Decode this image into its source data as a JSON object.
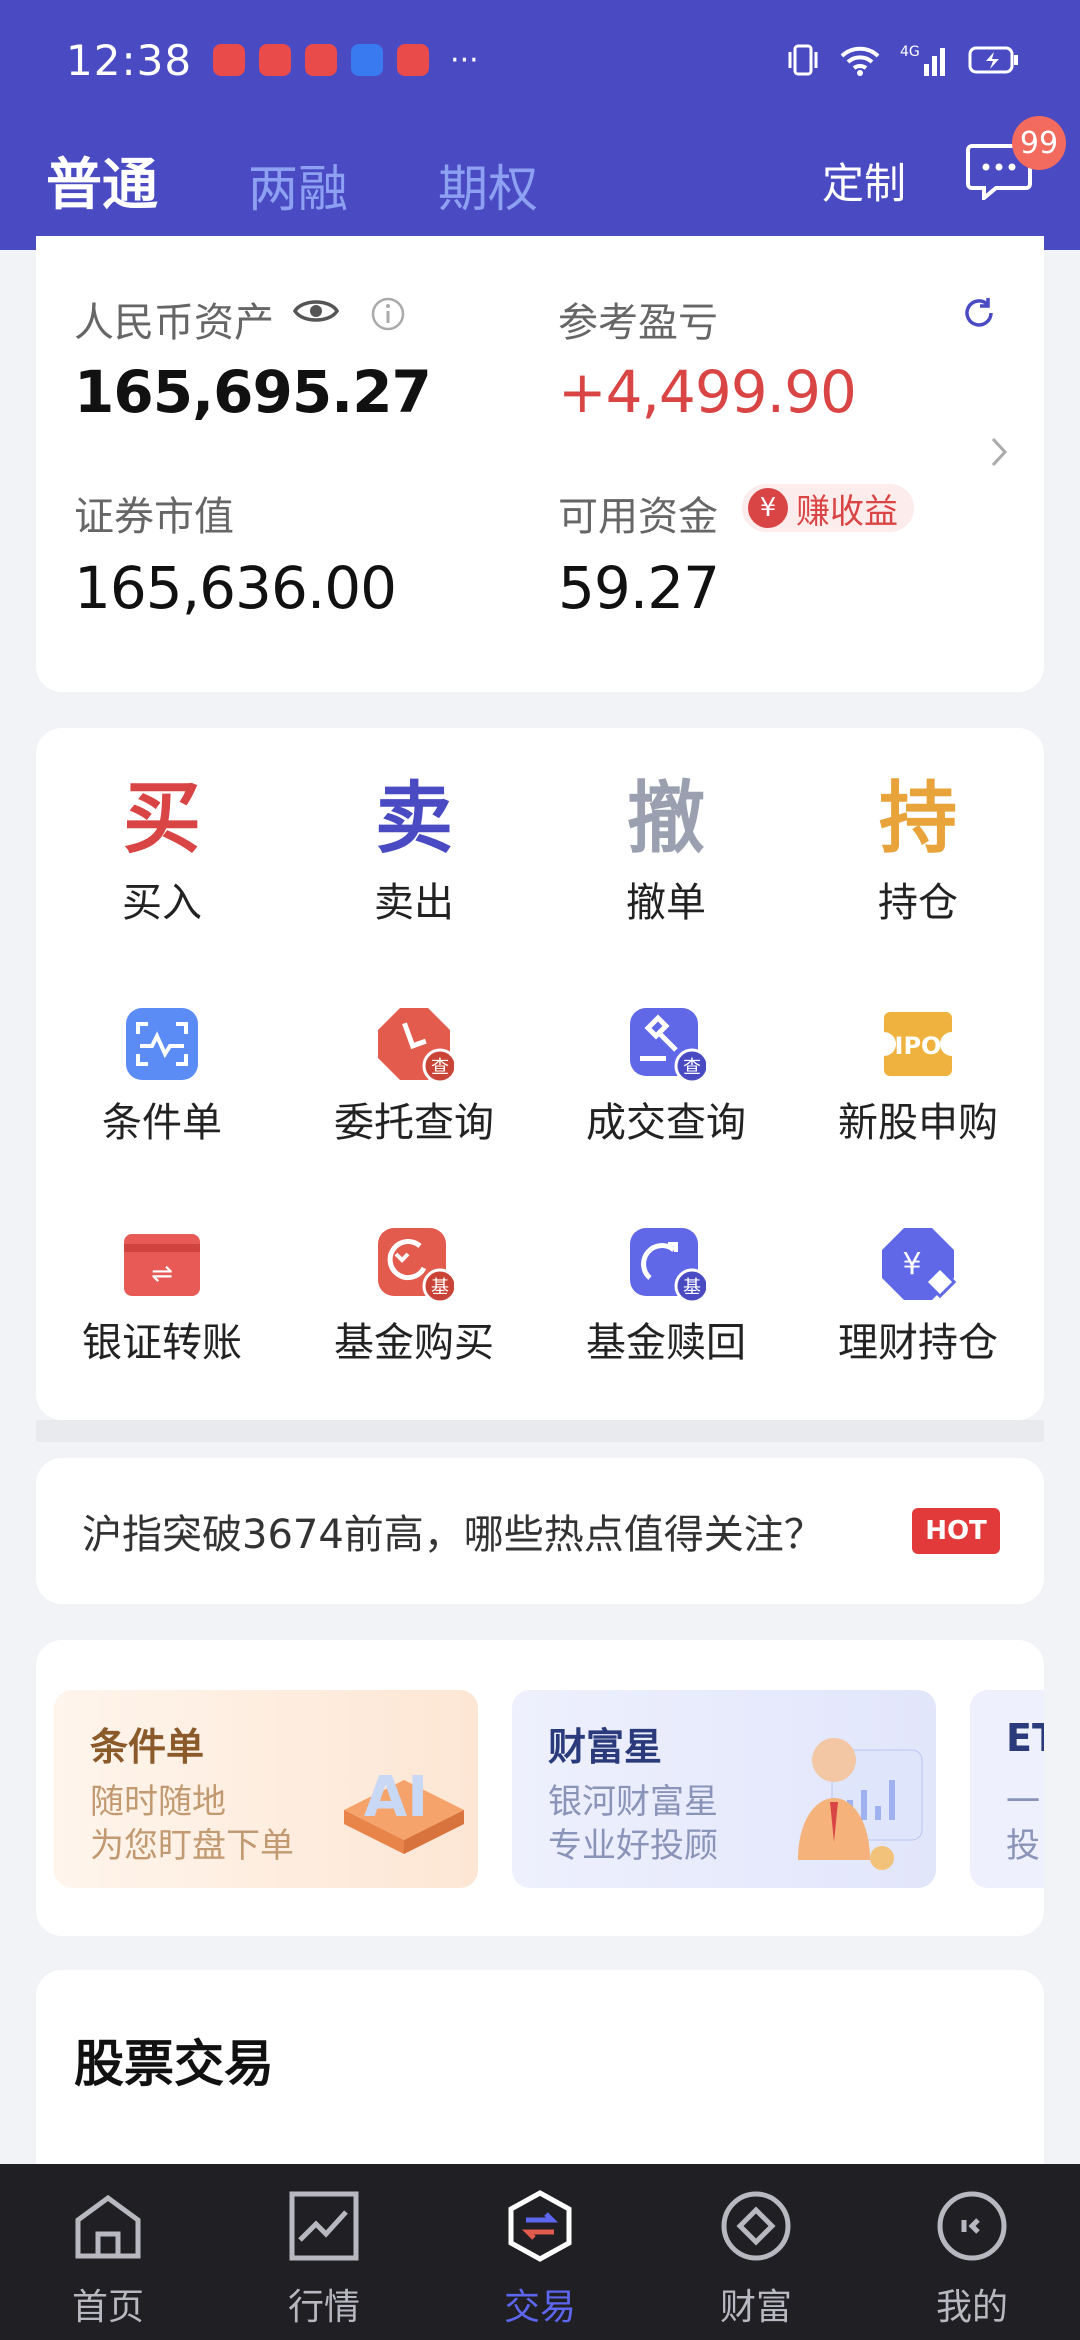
{
  "status": {
    "time": "12:38",
    "more": "···"
  },
  "tabs": [
    {
      "label": "普通"
    },
    {
      "label": "两融"
    },
    {
      "label": "期权"
    }
  ],
  "header": {
    "customize": "定制",
    "badge": "99"
  },
  "asset": {
    "rmb_label": "人民币资产",
    "rmb_value": "165,695.27",
    "pnl_label": "参考盈亏",
    "pnl_value": "+4,499.90",
    "market_label": "证券市值",
    "market_value": "165,636.00",
    "cash_label": "可用资金",
    "cash_value": "59.27",
    "earn_label": "赚收益",
    "earn_icon": "¥"
  },
  "actions": [
    {
      "char": "买",
      "label": "买入",
      "color": "#d94444"
    },
    {
      "char": "卖",
      "label": "卖出",
      "color": "#4a4bc3"
    },
    {
      "char": "撤",
      "label": "撤单",
      "color": "#9aa0b0"
    },
    {
      "char": "持",
      "label": "持仓",
      "color": "#e8a43a"
    }
  ],
  "services": [
    {
      "label": "条件单",
      "icon": "condition-order-icon"
    },
    {
      "label": "委托查询",
      "icon": "order-query-icon",
      "tag": "查"
    },
    {
      "label": "成交查询",
      "icon": "deal-query-icon",
      "tag": "查"
    },
    {
      "label": "新股申购",
      "icon": "ipo-icon",
      "text": "IPO"
    },
    {
      "label": "银证转账",
      "icon": "bank-transfer-icon",
      "text": "⇌"
    },
    {
      "label": "基金购买",
      "icon": "fund-buy-icon",
      "tag": "基"
    },
    {
      "label": "基金赎回",
      "icon": "fund-redeem-icon",
      "tag": "基"
    },
    {
      "label": "理财持仓",
      "icon": "wealth-holding-icon",
      "text": "¥"
    }
  ],
  "news": {
    "text": "沪指突破3674前高，哪些热点值得关注？",
    "badge": "HOT"
  },
  "banners": [
    {
      "title": "条件单",
      "line1": "随时随地",
      "line2": "为您盯盘下单"
    },
    {
      "title": "财富星",
      "line1": "银河财富星",
      "line2": "专业好投顾"
    },
    {
      "title": "ET",
      "line1": "一",
      "line2": "投"
    }
  ],
  "stock_section": {
    "title": "股票交易"
  },
  "nav": [
    {
      "label": "首页"
    },
    {
      "label": "行情"
    },
    {
      "label": "交易"
    },
    {
      "label": "财富"
    },
    {
      "label": "我的"
    }
  ]
}
